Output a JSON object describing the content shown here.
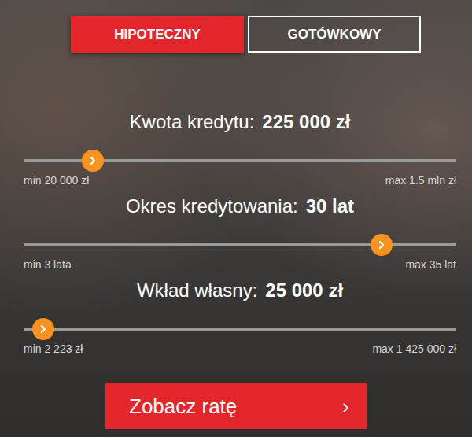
{
  "tabs": [
    {
      "label": "HIPOTECZNY",
      "selected": true
    },
    {
      "label": "GOTÓWKOWY",
      "selected": false
    }
  ],
  "sliders": [
    {
      "label": "Kwota kredytu:",
      "value": "225 000 zł",
      "level": 0.16,
      "min": "min 20 000 zł",
      "max": "max 1.5 mln zł"
    },
    {
      "label": "Okres kredytowania:",
      "value": "30 lat",
      "level": 0.828,
      "min": "min 3 lata",
      "max": "max 35 lat"
    },
    {
      "label": "Wkład własny:",
      "value": "25 000 zł",
      "level": 0.045,
      "min": "min 2 223 zł",
      "max": "max 1 425 000 zł"
    }
  ],
  "button": {
    "label": "Zobacz ratę",
    "arrow": "›"
  }
}
